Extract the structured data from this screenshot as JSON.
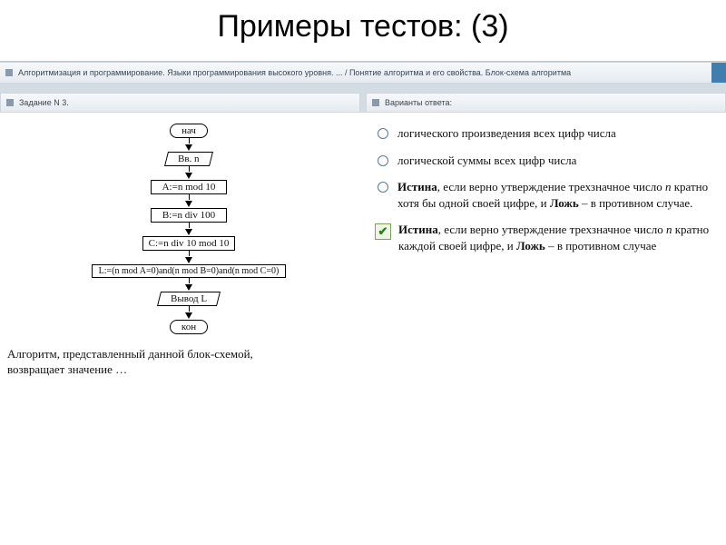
{
  "title": "Примеры тестов: (3)",
  "breadcrumb": "Алгоритмизация и программирование. Языки программирования высокого уровня. ... / Понятие алгоритма и его свойства. Блок-схема алгоритма",
  "tabs": {
    "left": "Задание N 3.",
    "right": "Варианты ответа:"
  },
  "flowchart": {
    "start": "нач",
    "input": "Вв. n",
    "b1": "A:=n mod 10",
    "b2": "B:=n div 100",
    "b3": "C:=n div 10 mod 10",
    "b4": "L:=(n mod A=0)and(n mod B=0)and(n mod C=0)",
    "output": "Вывод L",
    "end": "кон"
  },
  "question": "Алгоритм, представленный данной блок-схемой, возвращает значение …",
  "options": {
    "o1": "логического произведения всех цифр числа",
    "o2": "логической суммы всех цифр числа",
    "o3_a": "Истина",
    "o3_b": ", если верно утверждение трехзначное число ",
    "o3_c": "n",
    "o3_d": " кратно хотя бы одной своей цифре, и ",
    "o3_e": "Ложь",
    "o3_f": " – в противном случае.",
    "o4_a": "Истина",
    "o4_b": ", если верно утверждение трехзначное число ",
    "o4_c": "n",
    "o4_d": " кратно каждой своей цифре, и ",
    "o4_e": "Ложь",
    "o4_f": " – в противном случае"
  }
}
